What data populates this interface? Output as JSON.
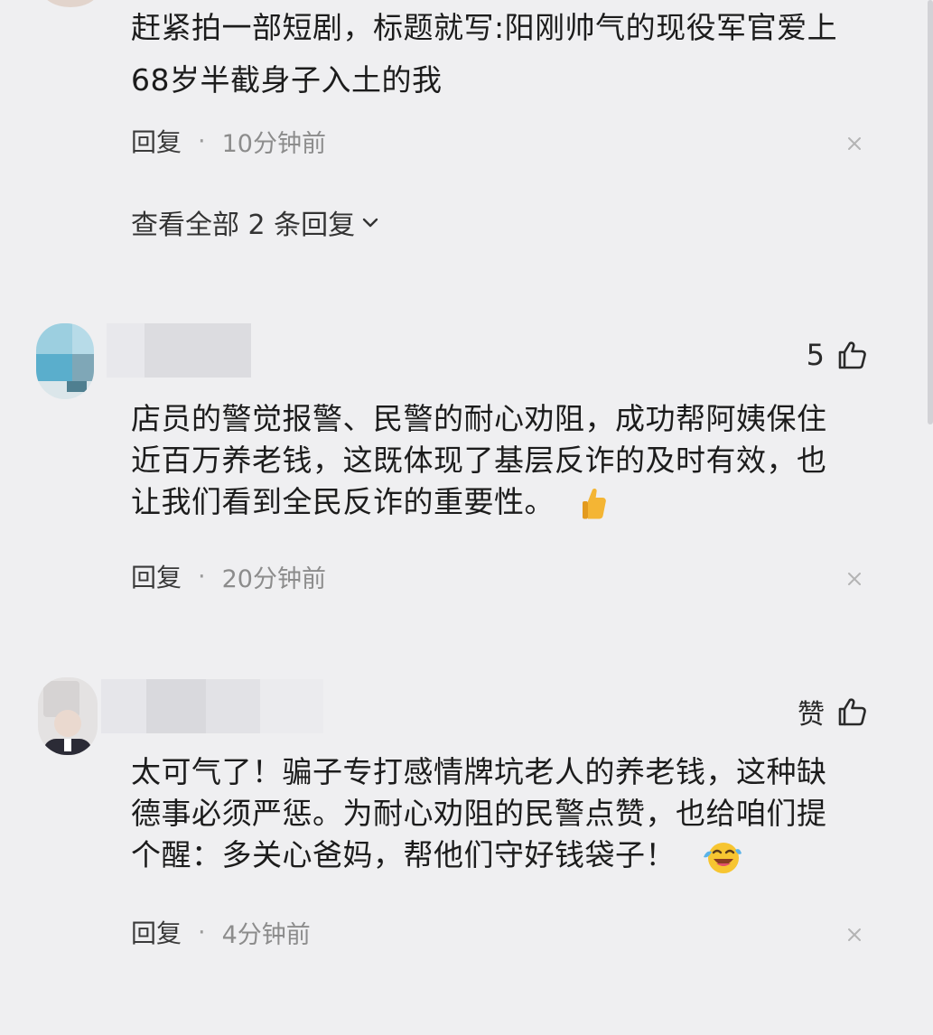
{
  "comment1": {
    "text_line1": "赶紧拍一部短剧，标题就写:阳刚帅气的现役军官爱上",
    "text_line2": "68岁半截身子入土的我",
    "reply_label": "回复",
    "separator": "·",
    "time": "10分钟前",
    "view_all_replies": "查看全部 2 条回复"
  },
  "comment2": {
    "likes": "5",
    "text_line1": "店员的警觉报警、民警的耐心劝阻，成功帮阿姨保住",
    "text_line2": "近百万养老钱，这既体现了基层反诈的及时有效，也",
    "text_line3": "让我们看到全民反诈的重要性。",
    "emoji": "thumbs-up-emoji",
    "reply_label": "回复",
    "separator": "·",
    "time": "20分钟前"
  },
  "comment3": {
    "likes": "赞",
    "text_line1": "太可气了！骗子专打感情牌坑老人的养老钱，这种缺",
    "text_line2": "德事必须严惩。为耐心劝阻的民警点赞，也给咱们提",
    "text_line3": "个醒：多关心爸妈，帮他们守好钱袋子！",
    "emoji": "laughing-crying-emoji",
    "reply_label": "回复",
    "separator": "·",
    "time": "4分钟前"
  },
  "colors": {
    "background": "#efeff1",
    "text": "#1c1c1c",
    "muted": "#8c8c8c"
  }
}
